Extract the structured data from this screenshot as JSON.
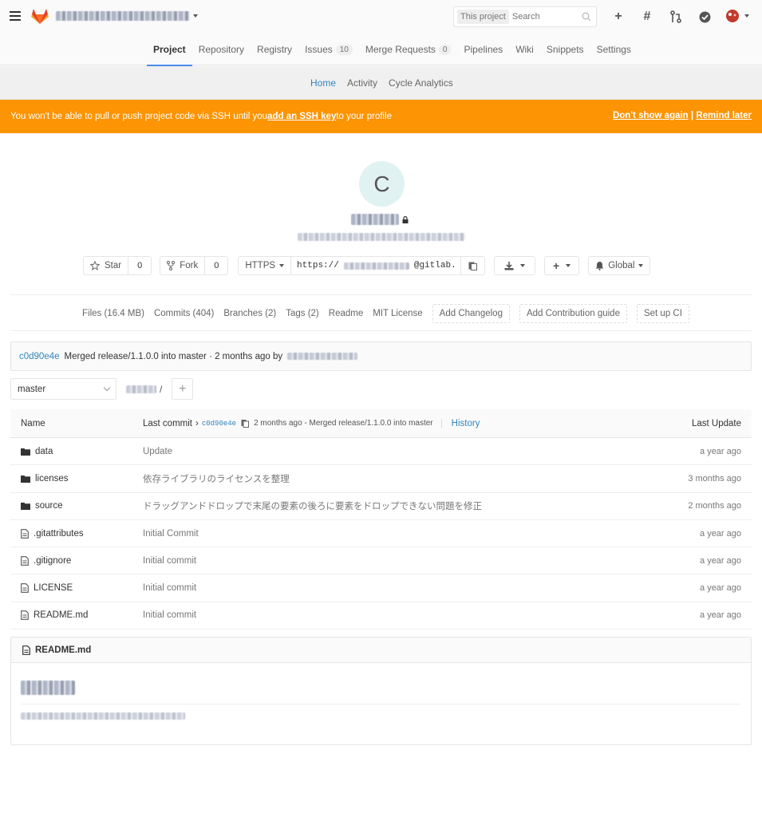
{
  "header": {
    "search_scope": "This project",
    "search_placeholder": "Search"
  },
  "nav_primary": [
    {
      "label": "Project",
      "active": true
    },
    {
      "label": "Repository"
    },
    {
      "label": "Registry"
    },
    {
      "label": "Issues",
      "badge": "10"
    },
    {
      "label": "Merge Requests",
      "badge": "0"
    },
    {
      "label": "Pipelines"
    },
    {
      "label": "Wiki"
    },
    {
      "label": "Snippets"
    },
    {
      "label": "Settings"
    }
  ],
  "nav_secondary": [
    {
      "label": "Home",
      "active": true
    },
    {
      "label": "Activity"
    },
    {
      "label": "Cycle Analytics"
    }
  ],
  "ssh_banner": {
    "text_before": "You won't be able to pull or push project code via SSH until you ",
    "link": "add an SSH key",
    "text_after": " to your profile",
    "dont_show": "Don't show again",
    "separator": " | ",
    "remind": "Remind later"
  },
  "project": {
    "avatar_letter": "C"
  },
  "actions": {
    "star_label": "Star",
    "star_count": "0",
    "fork_label": "Fork",
    "fork_count": "0",
    "protocol": "HTTPS",
    "url_prefix": "https://",
    "url_suffix": "@gitlab.",
    "notify_label": "Global"
  },
  "stats": {
    "files": "Files (16.4 MB)",
    "commits": "Commits (404)",
    "branches": "Branches (2)",
    "tags": "Tags (2)",
    "readme": "Readme",
    "license": "MIT License",
    "add_changelog": "Add Changelog",
    "add_contrib": "Add Contribution guide",
    "setup_ci": "Set up CI"
  },
  "last_commit": {
    "sha": "c0d90e4e",
    "message": "Merged release/1.1.0.0 into master · 2 months ago by"
  },
  "branch": {
    "name": "master",
    "path_sep": "/"
  },
  "tree_header": {
    "name": "Name",
    "last_commit_label": "Last commit",
    "sha": "c0d90e4e",
    "info": "2 months ago - Merged release/1.1.0.0 into master",
    "history": "History",
    "last_update": "Last Update"
  },
  "files": [
    {
      "name": "data",
      "type": "folder",
      "message": "Update",
      "date": "a year ago"
    },
    {
      "name": "licenses",
      "type": "folder",
      "message": "依存ライブラリのライセンスを整理",
      "date": "3 months ago"
    },
    {
      "name": "source",
      "type": "folder",
      "message": "ドラッグアンドドロップで末尾の要素の後ろに要素をドロップできない問題を修正",
      "date": "2 months ago"
    },
    {
      "name": ".gitattributes",
      "type": "file",
      "message": "Initial Commit",
      "date": "a year ago"
    },
    {
      "name": ".gitignore",
      "type": "file",
      "message": "Initial commit",
      "date": "a year ago"
    },
    {
      "name": "LICENSE",
      "type": "file",
      "message": "Initial commit",
      "date": "a year ago"
    },
    {
      "name": "README.md",
      "type": "file",
      "message": "Initial commit",
      "date": "a year ago"
    }
  ],
  "readme": {
    "filename": "README.md"
  },
  "colors": {
    "banner": "#fc9403",
    "link": "#3084bb",
    "nav_active_underline": "#4a8bee"
  }
}
